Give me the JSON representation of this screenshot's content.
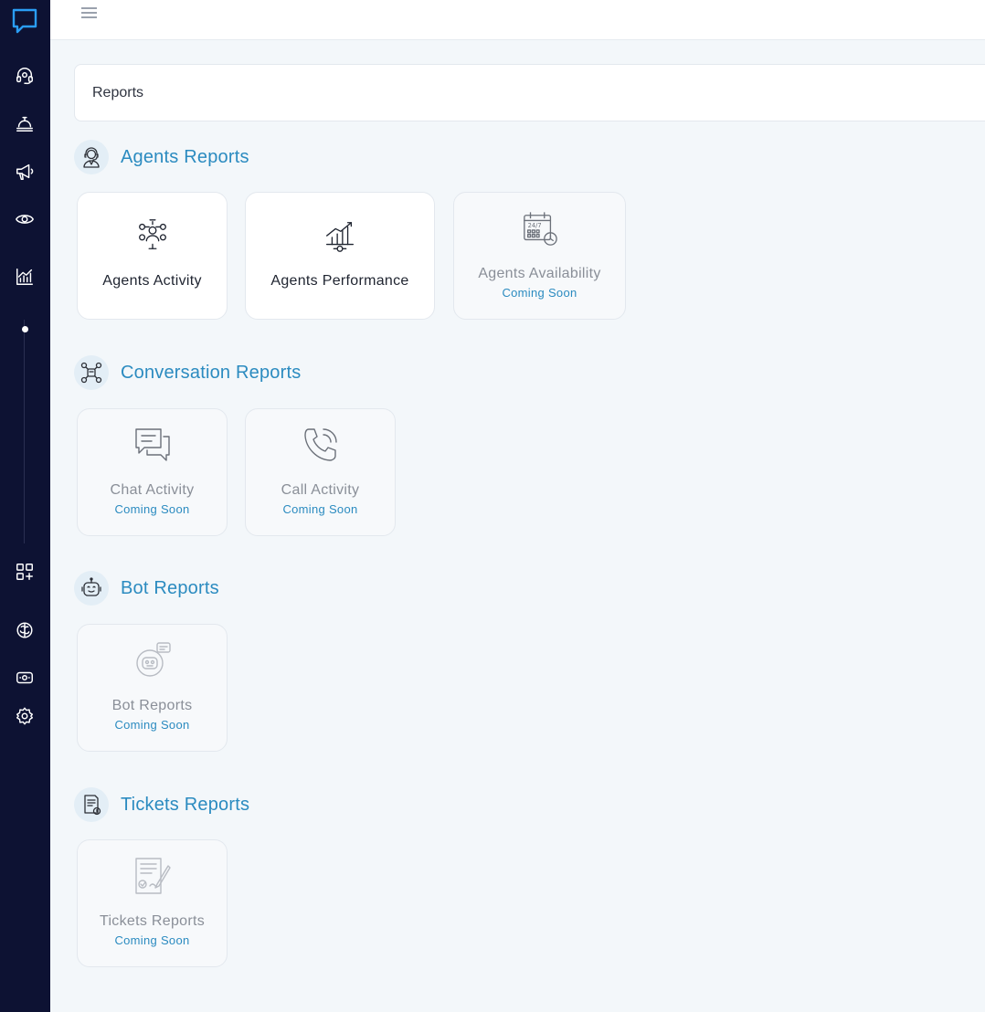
{
  "sidebar": {
    "items": [
      {
        "icon": "chat-logo-icon"
      },
      {
        "icon": "headset-icon"
      },
      {
        "icon": "service-bell-icon"
      },
      {
        "icon": "megaphone-icon"
      },
      {
        "icon": "eye-icon"
      },
      {
        "icon": "analytics-chart-icon"
      },
      {
        "icon": "add-widget-icon"
      },
      {
        "icon": "brain-icon"
      },
      {
        "icon": "billing-icon"
      },
      {
        "icon": "settings-gear-icon"
      }
    ]
  },
  "breadcrumb": {
    "title": "Reports"
  },
  "sections": {
    "agents": {
      "title": "Agents Reports",
      "icon": "agent-headset-icon",
      "cards": [
        {
          "label": "Agents Activity",
          "icon": "team-activity-icon"
        },
        {
          "label": "Agents Performance",
          "icon": "performance-growth-icon"
        },
        {
          "label": "Agents Availability",
          "icon": "calendar-24-7-icon",
          "status": "Coming Soon"
        }
      ]
    },
    "conversation": {
      "title": "Conversation Reports",
      "icon": "conversation-network-icon",
      "cards": [
        {
          "label": "Chat Activity",
          "icon": "chat-bubbles-icon",
          "status": "Coming Soon"
        },
        {
          "label": "Call Activity",
          "icon": "phone-call-icon",
          "status": "Coming Soon"
        }
      ]
    },
    "bot": {
      "title": "Bot Reports",
      "icon": "robot-icon",
      "cards": [
        {
          "label": "Bot Reports",
          "icon": "bot-chat-icon",
          "status": "Coming Soon"
        }
      ]
    },
    "tickets": {
      "title": "Tickets Reports",
      "icon": "ticket-document-icon",
      "cards": [
        {
          "label": "Tickets Reports",
          "icon": "signed-document-icon",
          "status": "Coming Soon"
        }
      ]
    }
  },
  "colors": {
    "sidebar_bg": "#0d1233",
    "accent": "#2b8bc0",
    "logo": "#2a9df4",
    "page_bg": "#f3f7fa"
  }
}
